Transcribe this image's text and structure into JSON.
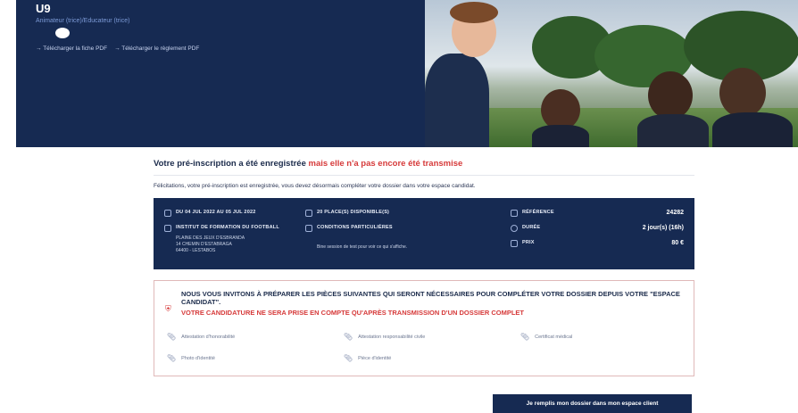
{
  "hero": {
    "title": "U9",
    "subtitle": "Animateur (trice)/Educateur (trice)",
    "links": [
      "→ Télécharger la fiche PDF",
      "→ Télécharger le règlement PDF"
    ]
  },
  "notice": {
    "part1": "Votre pré-inscription a été enregistrée ",
    "part2": "mais elle n'a pas encore été transmise"
  },
  "congrats": "Félicitations, votre pré-inscription est enregistrée, vous devez désormais compléter votre dossier dans votre espace candidat.",
  "info": {
    "dates": "DU 04 JUL 2022 AU 05 JUL 2022",
    "places": "20 PLACE(S) DISPONIBLE(S)",
    "reference_label": "RÉFÉRENCE",
    "reference_value": "24282",
    "institute": "INSTITUT DE FORMATION DU FOOTBALL",
    "conditions": "CONDITIONS PARTICULIÈRES",
    "duration_label": "DURÉE",
    "duration_value": "2 jour(s) (16h)",
    "address": [
      "PLAINE DES JEUX D'ESBRANDA",
      "14 CHEMIN D'ESTABRAGA",
      "64400 - LESTABOS"
    ],
    "conditions_text": "Bine session de test pour voir ce qui s'affiche.",
    "price_label": "PRIX",
    "price_value": "80 €"
  },
  "docs": {
    "heading": "NOUS VOUS INVITONS À PRÉPARER LES PIÈCES SUIVANTES QUI SERONT NÉCESSAIRES POUR COMPLÉTER VOTRE DOSSIER DEPUIS VOTRE \"ESPACE CANDIDAT\".",
    "warning": "VOTRE CANDIDATURE NE SERA PRISE EN COMPTE QU'APRÈS TRANSMISSION D'UN DOSSIER COMPLET",
    "items": [
      "Attestation d'honorabilité",
      "Attestation responsabilité civile",
      "Certificat médical",
      "Photo d'identité",
      "Pièce d'identité"
    ]
  },
  "cta": "Je remplis mon dossier dans mon espace client"
}
